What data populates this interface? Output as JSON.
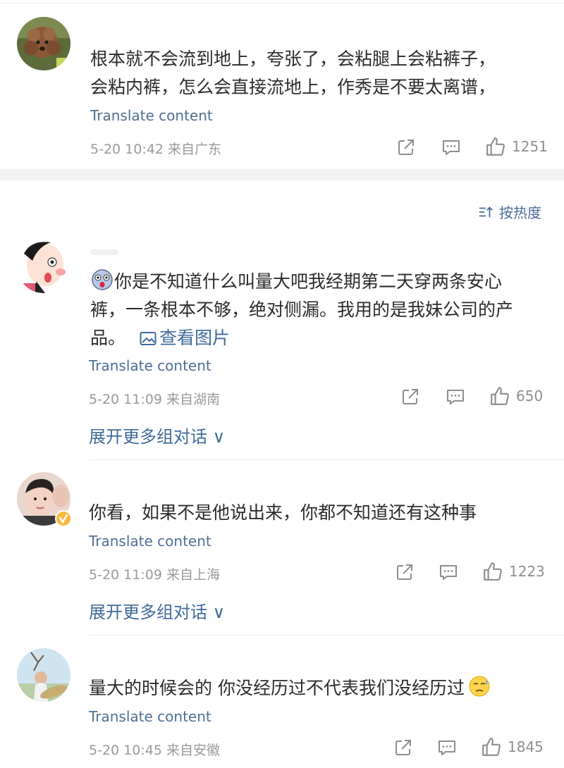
{
  "ui": {
    "translate_label": "Translate content",
    "expand_label": "展开更多组对话 ∨",
    "sort_label": "按热度",
    "view_image_label": "查看图片"
  },
  "colors": {
    "link_blue": "#3f6a99",
    "translate_blue": "#4e6f95",
    "meta_gray": "#9a9a9a",
    "band_gray": "#f2f2f2"
  },
  "comments": [
    {
      "text_line1": "根本就不会流到地上，夸张了，会粘腿上会粘裤子，",
      "text_line2": "会粘内裤，怎么会直接流地上，作秀是不要太离谱，",
      "time": "5-20 10:42",
      "location": "来自广东",
      "likes": "1251",
      "avatar_icon": "poodle-dog-avatar"
    },
    {
      "text_line1": "你是不知道什么叫量大吧我经期第二天穿两条安心",
      "text_line2": "裤，一条根本不够，绝对侧漏。我用的是我妹公司的产",
      "text_line3": "品。",
      "emoji_icon": "shocked-face-emoji",
      "time": "5-20 11:09",
      "location": "来自湖南",
      "likes": "650",
      "avatar_icon": "cartoon-girl-avatar"
    },
    {
      "text_line1": "你看，如果不是他说出来，你都不知道还有这种事",
      "time": "5-20 11:09",
      "location": "来自上海",
      "likes": "1223",
      "avatar_icon": "verified-man-avatar",
      "badge_icon": "verified-badge-icon"
    },
    {
      "text_line1": "量大的时候会的 你没经历过不代表我们没经历过",
      "emoji_icon": "sweat-face-emoji",
      "time": "5-20 10:45",
      "location": "来自安徽",
      "likes": "1845",
      "avatar_icon": "person-holding-fish-avatar"
    }
  ]
}
